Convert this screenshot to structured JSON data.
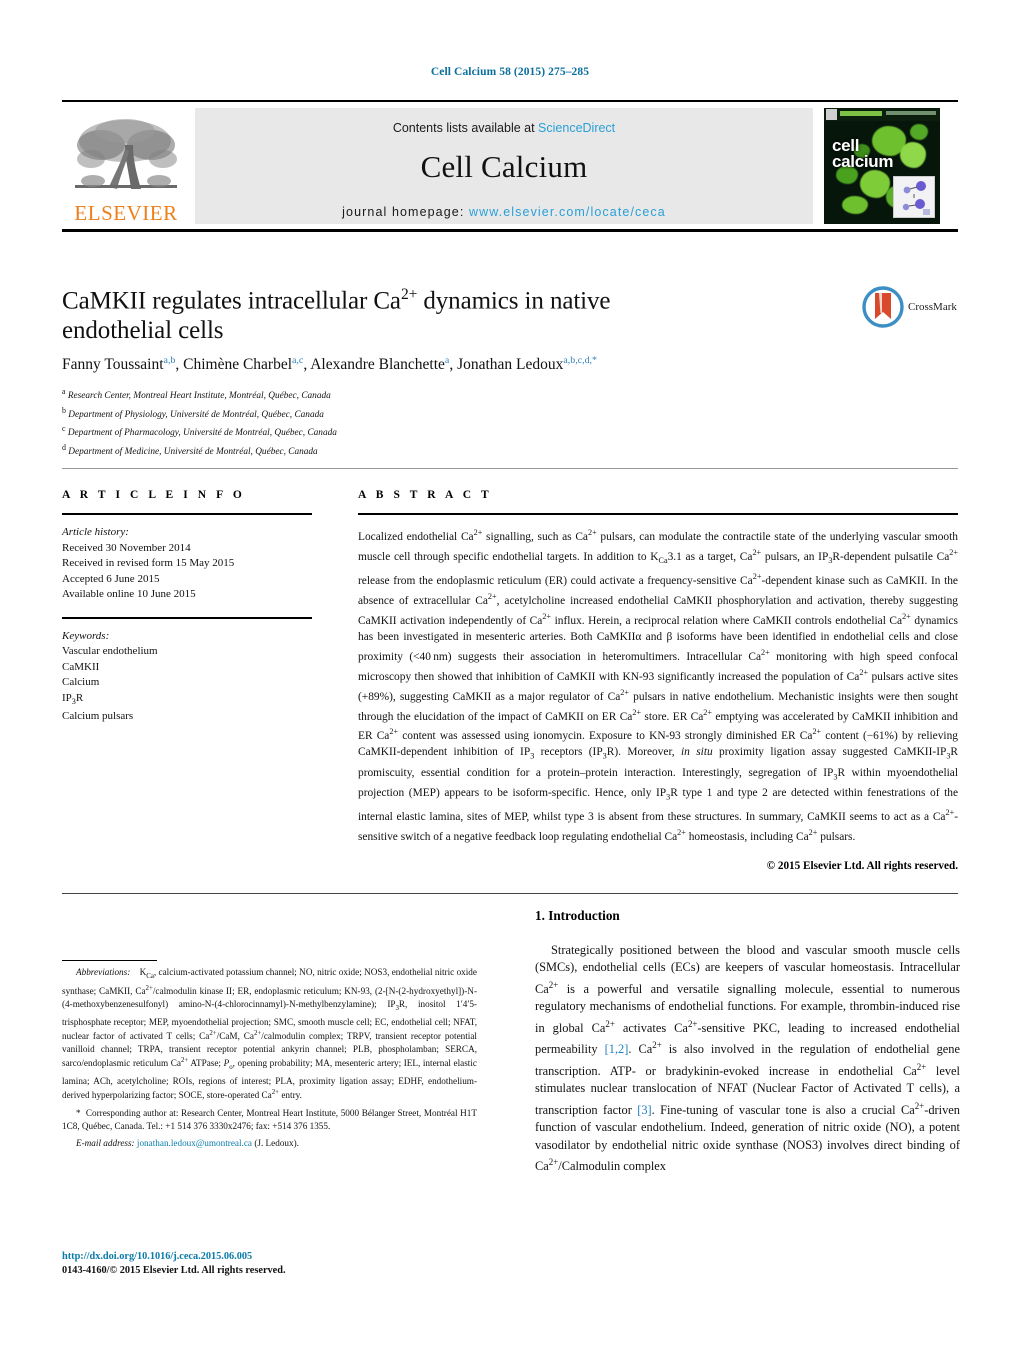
{
  "running_head": "Cell Calcium 58 (2015) 275–285",
  "masthead": {
    "contents_prefix": "Contents lists available at ",
    "contents_link": "ScienceDirect",
    "journal_name": "Cell Calcium",
    "homepage_prefix": "journal homepage: ",
    "homepage_url": "www.elsevier.com/locate/ceca",
    "publisher_wordmark": "ELSEVIER",
    "cover_title_line1": "cell",
    "cover_title_line2": "calcium"
  },
  "crossmark": {
    "label": "CrossMark"
  },
  "title": {
    "line1": "CaMKII regulates intracellular Ca",
    "sup1": "2+",
    "line1_rest": " dynamics in native",
    "line2": "endothelial cells",
    "full": "CaMKII regulates intracellular Ca2+ dynamics in native endothelial cells"
  },
  "authors": [
    {
      "name": "Fanny Toussaint",
      "marks": "a,b"
    },
    {
      "name": "Chimène Charbel",
      "marks": "a,c"
    },
    {
      "name": "Alexandre Blanchette",
      "marks": "a"
    },
    {
      "name": "Jonathan Ledoux",
      "marks": "a,b,c,d,*"
    }
  ],
  "affiliations": [
    {
      "mark": "a",
      "text": "Research Center, Montreal Heart Institute, Montréal, Québec, Canada"
    },
    {
      "mark": "b",
      "text": "Department of Physiology, Université de Montréal, Québec, Canada"
    },
    {
      "mark": "c",
      "text": "Department of Pharmacology, Université de Montréal, Québec, Canada"
    },
    {
      "mark": "d",
      "text": "Department of Medicine, Université de Montréal, Québec, Canada"
    }
  ],
  "article_info": {
    "heading": "A R T I C L E    I N F O",
    "history_label": "Article history:",
    "history": [
      "Received 30 November 2014",
      "Received in revised form 15 May 2015",
      "Accepted 6 June 2015",
      "Available online 10 June 2015"
    ],
    "keywords_label": "Keywords:",
    "keywords": [
      "Vascular endothelium",
      "CaMKII",
      "Calcium",
      "IP3R",
      "Calcium pulsars"
    ]
  },
  "abstract": {
    "heading": "A B S T R A C T",
    "copyright": "© 2015 Elsevier Ltd. All rights reserved.",
    "text": "Localized endothelial Ca2+ signalling, such as Ca2+ pulsars, can modulate the contractile state of the underlying vascular smooth muscle cell through specific endothelial targets. In addition to KCa3.1 as a target, Ca2+ pulsars, an IP3R-dependent pulsatile Ca2+ release from the endoplasmic reticulum (ER) could activate a frequency-sensitive Ca2+-dependent kinase such as CaMKII. In the absence of extracellular Ca2+, acetylcholine increased endothelial CaMKII phosphorylation and activation, thereby suggesting CaMKII activation independently of Ca2+ influx. Herein, a reciprocal relation where CaMKII controls endothelial Ca2+ dynamics has been investigated in mesenteric arteries. Both CaMKIIα and β isoforms have been identified in endothelial cells and close proximity (<40 nm) suggests their association in heteromultimers. Intracellular Ca2+ monitoring with high speed confocal microscopy then showed that inhibition of CaMKII with KN-93 significantly increased the population of Ca2+ pulsars active sites (+89%), suggesting CaMKII as a major regulator of Ca2+ pulsars in native endothelium. Mechanistic insights were then sought through the elucidation of the impact of CaMKII on ER Ca2+ store. ER Ca2+ emptying was accelerated by CaMKII inhibition and ER Ca2+ content was assessed using ionomycin. Exposure to KN-93 strongly diminished ER Ca2+ content (−61%) by relieving CaMKII-dependent inhibition of IP3 receptors (IP3R). Moreover, in situ proximity ligation assay suggested CaMKII-IP3R promiscuity, essential condition for a protein–protein interaction. Interestingly, segregation of IP3R within myoendothelial projection (MEP) appears to be isoform-specific. Hence, only IP3R type 1 and type 2 are detected within fenestrations of the internal elastic lamina, sites of MEP, whilst type 3 is absent from these structures. In summary, CaMKII seems to act as a Ca2+-sensitive switch of a negative feedback loop regulating endothelial Ca2+ homeostasis, including Ca2+ pulsars."
  },
  "footnotes": {
    "abbreviations_label": "Abbreviations:",
    "abbreviations_text": "KCa, calcium-activated potassium channel; NO, nitric oxide; NOS3, endothelial nitric oxide synthase; CaMKII, Ca2+/calmodulin kinase II; ER, endoplasmic reticulum; KN-93, (2-[N-(2-hydroxyethyl])-N-(4-methoxybenzenesulfonyl) amino-N-(4-chlorocinnamyl)-N-methylbenzylamine); IP3R, inositol 1′4′5-trisphosphate receptor; MEP, myoendothelial projection; SMC, smooth muscle cell; EC, endothelial cell; NFAT, nuclear factor of activated T cells; Ca2+/CaM, Ca2+/calmodulin complex; TRPV, transient receptor potential vanilloid channel; TRPA, transient receptor potential ankyrin channel; PLB, phospholamban; SERCA, sarco/endoplasmic reticulum Ca2+ ATPase; Po, opening probability; MA, mesenteric artery; IEL, internal elastic lamina; ACh, acetylcholine; ROIs, regions of interest; PLA, proximity ligation assay; EDHF, endothelium-derived hyperpolarizing factor; SOCE, store-operated Ca2+ entry.",
    "corresponding_marker": "*",
    "corresponding_text": "Corresponding author at: Research Center, Montreal Heart Institute, 5000 Bélanger Street, Montréal H1T 1C8, Québec, Canada. Tel.: +1 514 376 3330x2476; fax: +514 376 1355.",
    "email_label": "E-mail address:",
    "email": "jonathan.ledoux@umontreal.ca",
    "email_suffix": "(J. Ledoux).",
    "doi": "http://dx.doi.org/10.1016/j.ceca.2015.06.005",
    "issn_line": "0143-4160/© 2015 Elsevier Ltd. All rights reserved."
  },
  "introduction": {
    "heading": "1. Introduction",
    "paragraph": "Strategically positioned between the blood and vascular smooth muscle cells (SMCs), endothelial cells (ECs) are keepers of vascular homeostasis. Intracellular Ca2+ is a powerful and versatile signalling molecule, essential to numerous regulatory mechanisms of endothelial functions. For example, thrombin-induced rise in global Ca2+ activates Ca2+-sensitive PKC, leading to increased endothelial permeability [1,2]. Ca2+ is also involved in the regulation of endothelial gene transcription. ATP- or bradykinin-evoked increase in endothelial Ca2+ level stimulates nuclear translocation of NFAT (Nuclear Factor of Activated T cells), a transcription factor [3]. Fine-tuning of vascular tone is also a crucial Ca2+-driven function of vascular endothelium. Indeed, generation of nitric oxide (NO), a potent vasodilator by endothelial nitric oxide synthase (NOS3) involves direct binding of Ca2+/Calmodulin complex",
    "citations": [
      "[1,2]",
      "[3]"
    ]
  },
  "colors": {
    "link_blue": "#2aa0d8",
    "header_blue": "#0b6f9d",
    "elsevier_orange": "#ef7f1a",
    "cover_green": "#7cc143",
    "citation_blue": "#1f7fc0"
  }
}
